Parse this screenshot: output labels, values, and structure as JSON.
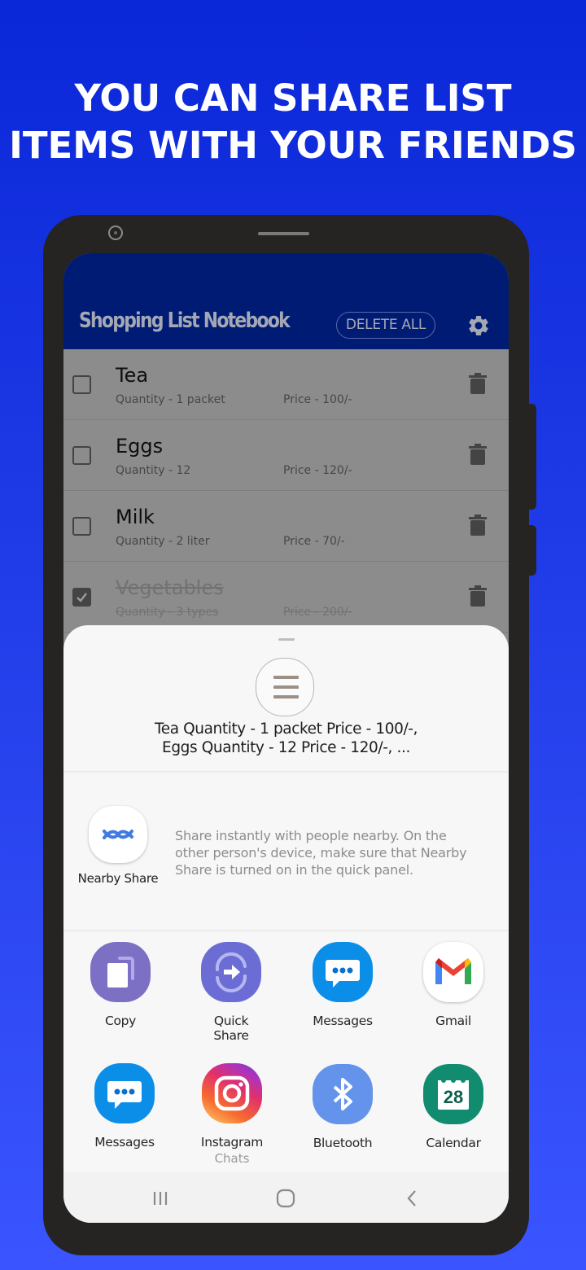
{
  "headline": {
    "line1": "YOU CAN SHARE LIST",
    "line2": "ITEMS WITH YOUR FRIENDS"
  },
  "colors": {
    "background_top": "#0a27d8",
    "background_bottom": "#3a55ff",
    "phone_frame": "#252422",
    "appbar": "#001b73",
    "accent_blue": "#4285f4"
  },
  "app": {
    "title": "Shopping List Notebook",
    "delete_all_label": "DELETE ALL",
    "settings_icon": "gear-icon"
  },
  "items": [
    {
      "name": "Tea",
      "quantity": "Quantity - 1 packet",
      "price": "Price - 100/-",
      "checked": false
    },
    {
      "name": "Eggs",
      "quantity": "Quantity - 12",
      "price": "Price - 120/-",
      "checked": false
    },
    {
      "name": "Milk",
      "quantity": "Quantity - 2 liter",
      "price": "Price - 70/-",
      "checked": false
    },
    {
      "name": "Vegetables",
      "quantity": "Quantity - 3 types",
      "price": "Price - 200/-",
      "checked": true
    }
  ],
  "share_sheet": {
    "preview_icon": "text-lines-icon",
    "preview_line1": "Tea Quantity - 1 packet Price - 100/-,",
    "preview_line2": "Eggs Quantity - 12 Price - 120/-, ...",
    "nearby": {
      "label": "Nearby Share",
      "description": "Share instantly with people nearby. On the other person's device, make sure that Nearby Share is turned on in the quick panel."
    },
    "apps": [
      {
        "label": "Copy",
        "sub": "",
        "icon": "copy-icon",
        "color": "#7b70c4"
      },
      {
        "label": "Quick\nShare",
        "sub": "",
        "icon": "quick-share-icon",
        "color": "#6c6dd4",
        "pinned": true
      },
      {
        "label": "Messages",
        "sub": "",
        "icon": "messages-icon",
        "color": "#0a8ee8"
      },
      {
        "label": "Gmail",
        "sub": "",
        "icon": "gmail-icon",
        "color": "#ffffff"
      },
      {
        "label": "Messages",
        "sub": "",
        "icon": "messages-icon",
        "color": "#0a8ee8"
      },
      {
        "label": "Instagram",
        "sub": "Chats",
        "icon": "instagram-icon",
        "color": "#e1306c"
      },
      {
        "label": "Bluetooth",
        "sub": "",
        "icon": "bluetooth-icon",
        "color": "#6393ea"
      },
      {
        "label": "Calendar",
        "sub": "",
        "icon": "calendar-icon",
        "color": "#128c6f",
        "day": "28"
      }
    ]
  },
  "navbar": {
    "recents": "recents-icon",
    "home": "home-icon",
    "back": "back-icon"
  }
}
